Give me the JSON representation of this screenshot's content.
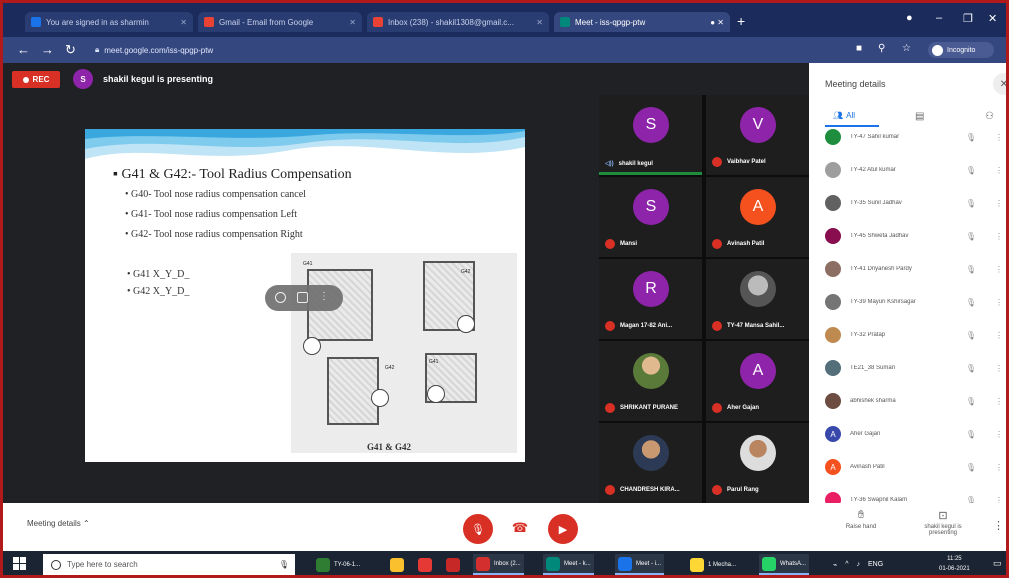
{
  "browser": {
    "tabs": [
      {
        "label": "You are signed in as sharmin",
        "color": "#1a73e8"
      },
      {
        "label": "Gmail - Email from Google",
        "color": "#ea4335"
      },
      {
        "label": "Inbox (238) - shakil1308@gmail.c...",
        "color": "#ea4335"
      },
      {
        "label": "Meet - iss-qpgp-ptw",
        "color": "#00897b"
      }
    ],
    "url": "meet.google.com/iss-qpgp-ptw",
    "profile_label": "Incognito"
  },
  "meet": {
    "rec_label": "REC",
    "presenter_initial": "S",
    "presenter_text": "shakil kegul is presenting",
    "slide": {
      "title": "G41 & G42:- Tool Radius Compensation",
      "bullets": [
        "G40- Tool nose radius compensation cancel",
        "G41- Tool nose radius compensation Left",
        "G42- Tool nose radius compensation Right"
      ],
      "codes": [
        "G41 X_Y_D_",
        "G42 X_Y_D_"
      ],
      "figure_caption": "G41 & G42",
      "figure_labels": [
        "G41",
        "G42",
        "G42",
        "G41"
      ]
    },
    "tiles": [
      {
        "initial": "S",
        "name": "shakil kegul",
        "color": "#8e24aa",
        "speaking": true
      },
      {
        "initial": "V",
        "name": "Vaibhav Patel",
        "color": "#8e24aa"
      },
      {
        "initial": "S",
        "name": "Mansi",
        "color": "#8e24aa"
      },
      {
        "initial": "A",
        "name": "Avinash Patil",
        "color": "#f4511e"
      },
      {
        "initial": "R",
        "name": "Magan 17-82 Ani...",
        "color": "#8e24aa"
      },
      {
        "initial": "",
        "name": "TY-47 Mansa Sahil...",
        "photo": "photo2"
      },
      {
        "initial": "",
        "name": "SHRIKANT PURANE",
        "photo": "photo1"
      },
      {
        "initial": "A",
        "name": "Aher Gajan",
        "color": "#8e24aa"
      },
      {
        "initial": "",
        "name": "CHANDRESH KIRA...",
        "photo": "photo3"
      },
      {
        "initial": "",
        "name": "Parul Rang",
        "photo": "photo4"
      }
    ]
  },
  "panel": {
    "title": "Meeting details",
    "tab_people": "All",
    "participants": [
      {
        "name": "TY-47 Sahil kumar",
        "color": "#1e8e3e",
        "initial": ""
      },
      {
        "name": "TY-42 Atul kumar",
        "color": "#9e9e9e",
        "initial": ""
      },
      {
        "name": "TY-35 Sunil Jadhav",
        "color": "#616161",
        "initial": ""
      },
      {
        "name": "TY-45 Shweta Jadhav",
        "color": "#880e4f",
        "initial": ""
      },
      {
        "name": "TY-41 Dnyanesh Pardy",
        "color": "#8d6e63",
        "initial": ""
      },
      {
        "name": "TY-39 Mayuri Kshirsagar",
        "color": "#757575",
        "initial": ""
      },
      {
        "name": "TY-32 Pratap",
        "color": "#bf8a4f",
        "initial": ""
      },
      {
        "name": "TE21_38 Suman",
        "color": "#546e7a",
        "initial": ""
      },
      {
        "name": "abhishek sharma",
        "color": "#6d4c41",
        "initial": ""
      },
      {
        "name": "Aher Gajan",
        "color": "#3949ab",
        "initial": "A"
      },
      {
        "name": "Avinash Patil",
        "color": "#f4511e",
        "initial": "A"
      },
      {
        "name": "TY-36 Swapnil Kalam",
        "color": "#e91e63",
        "initial": ""
      }
    ]
  },
  "bottom": {
    "meeting_details": "Meeting details",
    "raise_hand": "Raise hand",
    "presenting": "shakil kegul is presenting"
  },
  "taskbar": {
    "search_placeholder": "Type here to search",
    "apps": [
      {
        "label": "TY-06-1...",
        "color": "#2e7d32"
      },
      {
        "label": "",
        "color": "#fbc02d"
      },
      {
        "label": "",
        "color": "#e53935"
      },
      {
        "label": "",
        "color": "#c62828"
      },
      {
        "label": "Inbox (2...",
        "color": "#d32f2f"
      },
      {
        "label": "Meet - k...",
        "color": "#00897b"
      },
      {
        "label": "Meet - i...",
        "color": "#1a73e8"
      },
      {
        "label": "1 Mecha...",
        "color": "#fdd835"
      },
      {
        "label": "WhatsA...",
        "color": "#25d366"
      }
    ],
    "lang": "ENG",
    "time": "11:25",
    "date": "01-06-2021"
  }
}
